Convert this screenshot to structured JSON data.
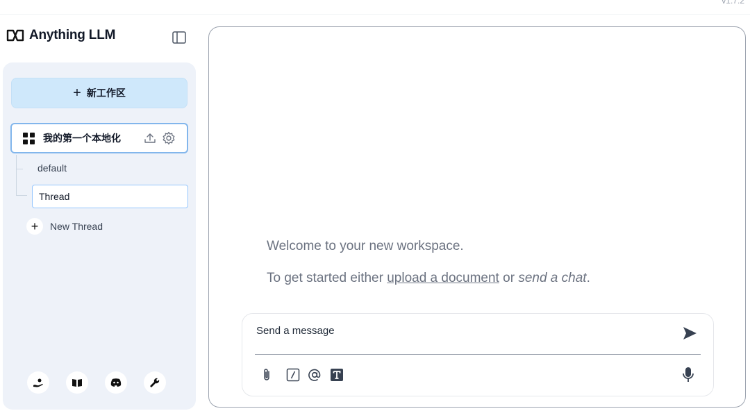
{
  "version": "v1.7.2",
  "brand": {
    "name": "Anything LLM"
  },
  "sidebar": {
    "new_workspace_label": "新工作区",
    "workspace": {
      "name": "我的第一个本地化"
    },
    "threads": [
      {
        "label": "default"
      },
      {
        "label": "Thread"
      }
    ],
    "new_thread_label": "New Thread",
    "footer_icons": [
      "community-hub-icon",
      "docs-book-icon",
      "discord-icon",
      "settings-wrench-icon"
    ]
  },
  "main": {
    "welcome_text": "Welcome to your new workspace.",
    "getstarted_prefix": "To get started either",
    "upload_link": "upload a document",
    "or_text": "or",
    "send_chat_link": "send a chat",
    "period": ".",
    "input_placeholder": "Send a message",
    "tools": [
      "attach-icon",
      "slash-command-icon",
      "at-mention-icon",
      "text-size-icon"
    ]
  }
}
